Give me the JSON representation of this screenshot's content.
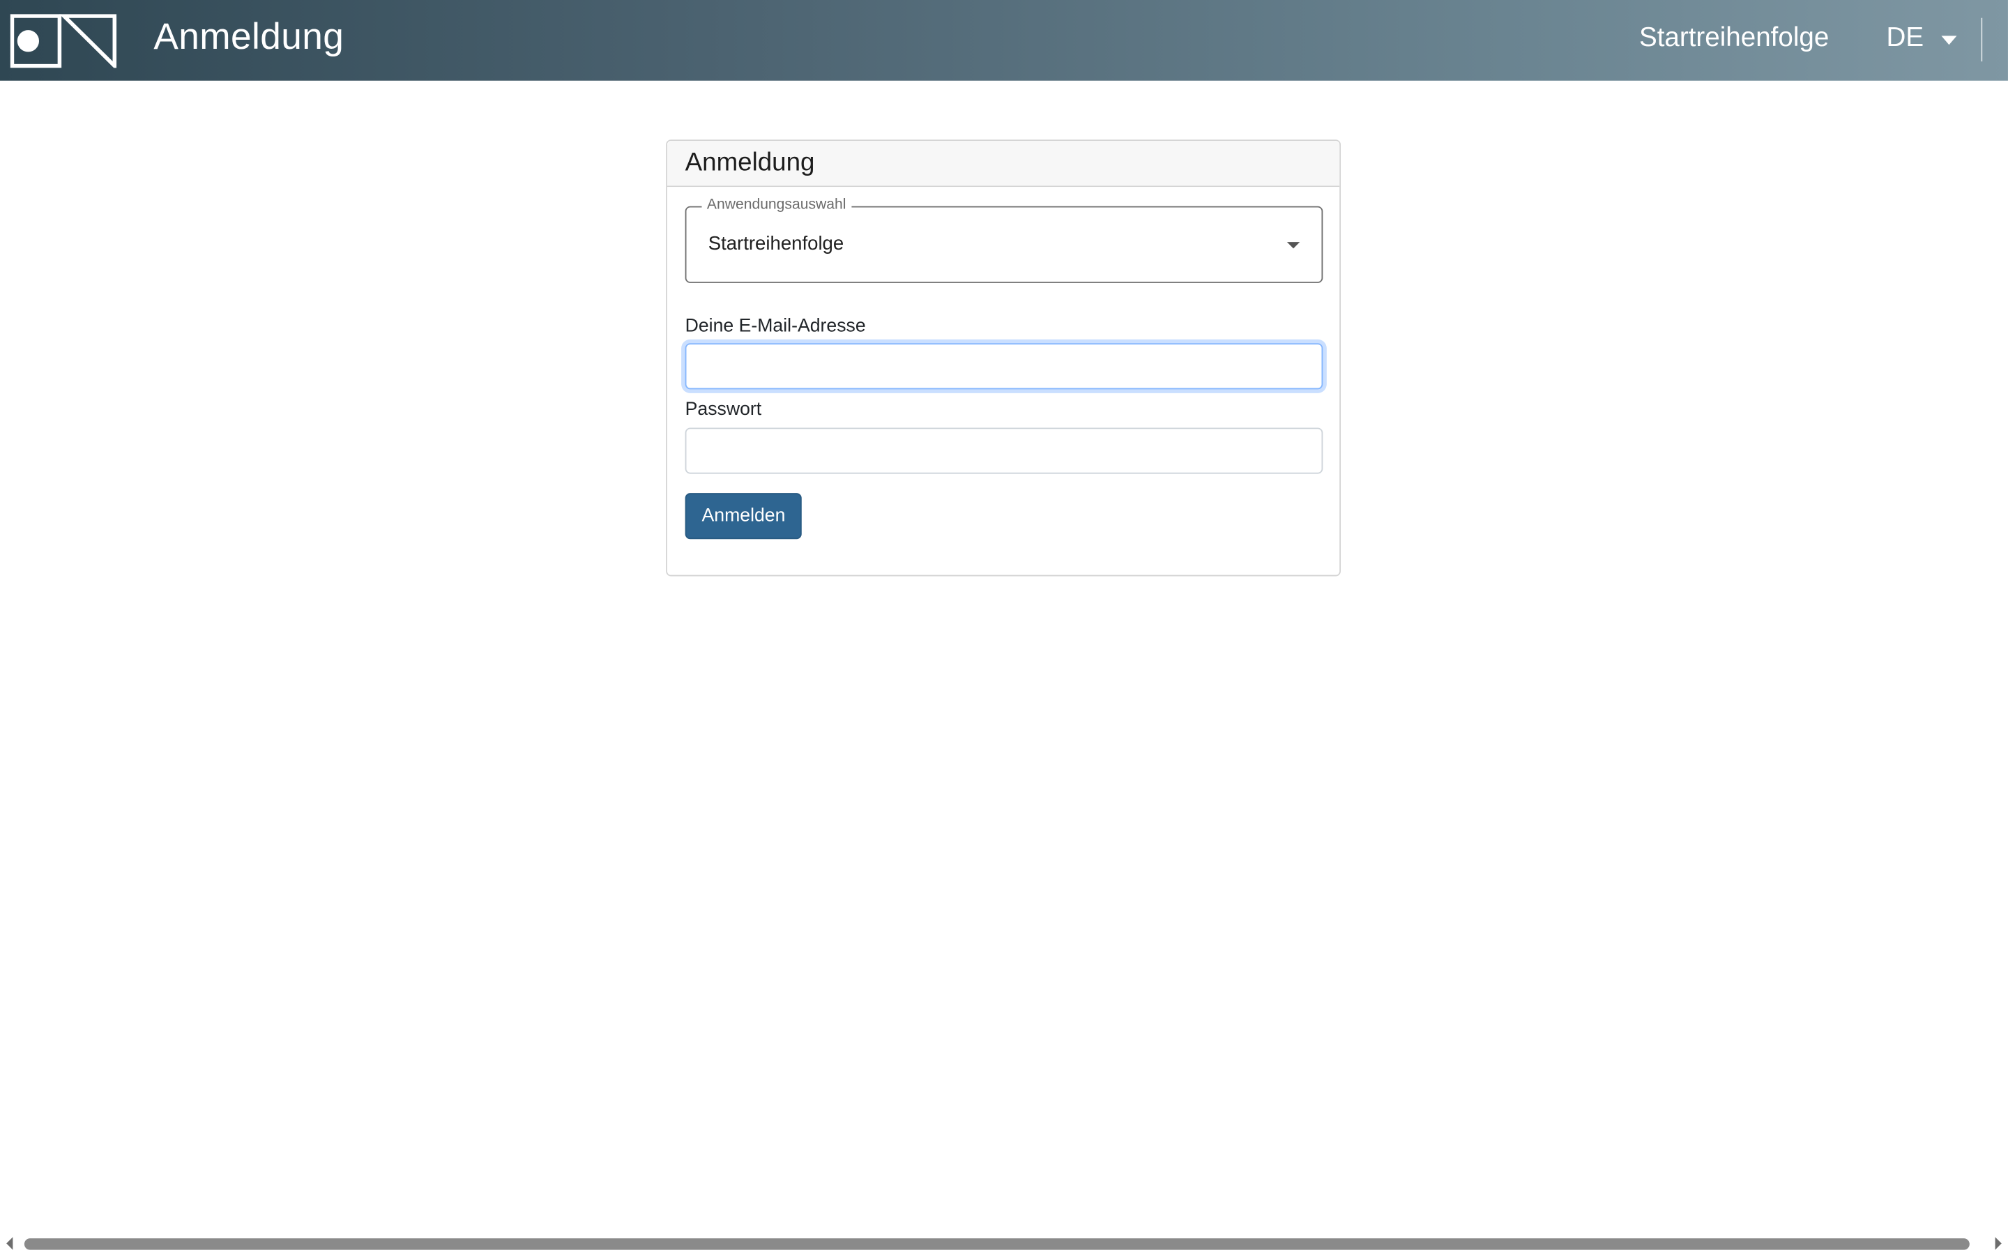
{
  "header": {
    "title": "Anmeldung",
    "nav_link": "Startreihenfolge",
    "language": "DE",
    "logo_icon": "app-logo-icon",
    "gradient_start": "#2f4753",
    "gradient_end": "#7f97a3"
  },
  "card": {
    "title": "Anmeldung",
    "app_select": {
      "legend": "Anwendungsauswahl",
      "value": "Startreihenfolge"
    },
    "email": {
      "label": "Deine E-Mail-Adresse",
      "value": "",
      "placeholder": ""
    },
    "password": {
      "label": "Passwort",
      "value": "",
      "placeholder": ""
    },
    "submit_label": "Anmelden",
    "button_color": "#2e6591"
  }
}
